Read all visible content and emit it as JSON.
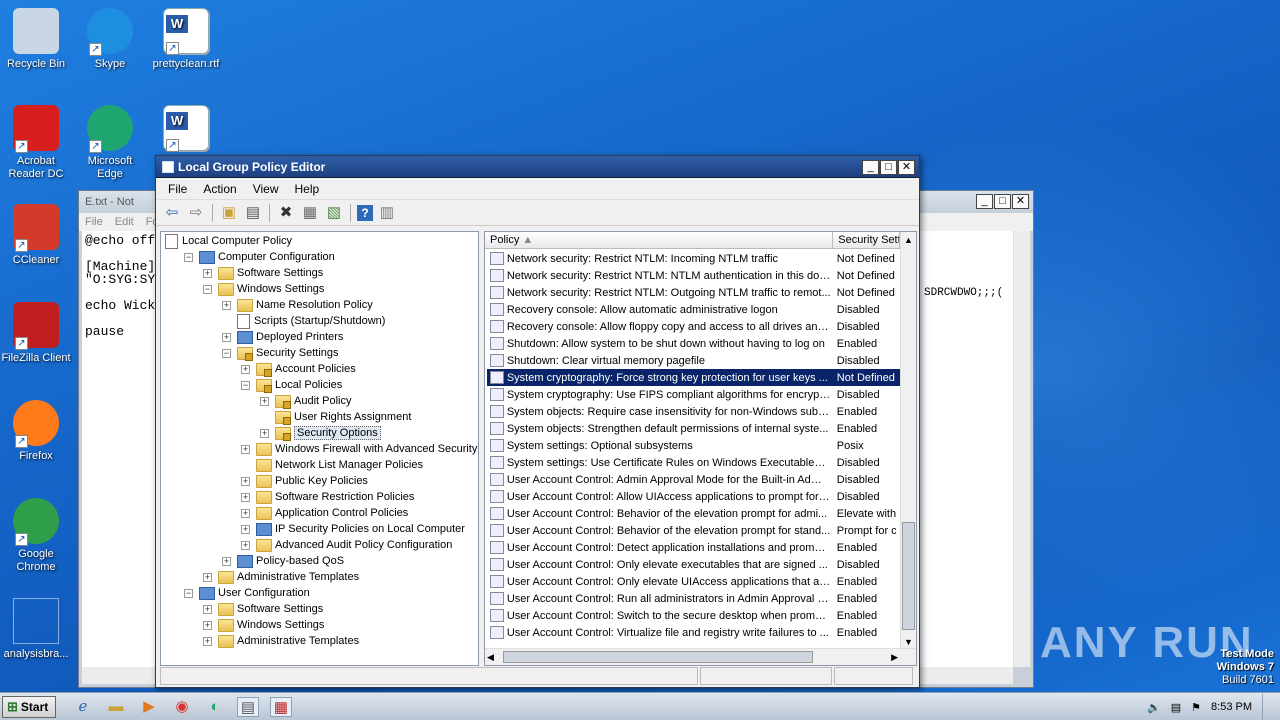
{
  "desktop": {
    "icons": [
      {
        "label": "Recycle Bin",
        "icon": "recycle-bin-icon",
        "color": "#c9d6e4"
      },
      {
        "label": "Skype",
        "icon": "skype-icon",
        "color": "#1e8fe0"
      },
      {
        "label": "prettyclean.rtf",
        "icon": "word-document-icon",
        "color": "#ffffff"
      },
      {
        "label": "Acrobat Reader DC",
        "icon": "acrobat-icon",
        "color": "#d81f1f"
      },
      {
        "label": "Microsoft Edge",
        "icon": "edge-icon",
        "color": "#1fa56f"
      },
      {
        "label": "",
        "icon": "word-document-icon",
        "color": "#ffffff"
      },
      {
        "label": "CCleaner",
        "icon": "ccleaner-icon",
        "color": "#d33a2c"
      },
      {
        "label": "FileZilla Client",
        "icon": "filezilla-icon",
        "color": "#bf1f1f"
      },
      {
        "label": "Firefox",
        "icon": "firefox-icon",
        "color": "#ff7a1a"
      },
      {
        "label": "Google Chrome",
        "icon": "chrome-icon",
        "color": "#2f9e4b"
      },
      {
        "label": "analysisbra...",
        "icon": "blank-file-icon",
        "color": "#1565c8"
      }
    ]
  },
  "notepad": {
    "title": "E.txt - Not",
    "menu": [
      "File",
      "Edit",
      "Fo"
    ],
    "content": "@echo off\n\n[Machine]\n\"O:SYG:SY\n\necho Wick\n\npause",
    "right_text": "SDRCWDWO;;;("
  },
  "gpedit": {
    "title": "Local Group Policy Editor",
    "menu": [
      "File",
      "Action",
      "View",
      "Help"
    ],
    "tree": [
      {
        "label": "Local Computer Policy",
        "level": 0,
        "exp": "",
        "icon": "doc"
      },
      {
        "label": "Computer Configuration",
        "level": 1,
        "exp": "−",
        "icon": "comp"
      },
      {
        "label": "Software Settings",
        "level": 2,
        "exp": "+",
        "icon": "fold"
      },
      {
        "label": "Windows Settings",
        "level": 2,
        "exp": "−",
        "icon": "fold"
      },
      {
        "label": "Name Resolution Policy",
        "level": 3,
        "exp": "+",
        "icon": "fold"
      },
      {
        "label": "Scripts (Startup/Shutdown)",
        "level": 3,
        "exp": "",
        "icon": "doc"
      },
      {
        "label": "Deployed Printers",
        "level": 3,
        "exp": "+",
        "icon": "comp"
      },
      {
        "label": "Security Settings",
        "level": 3,
        "exp": "−",
        "icon": "lock"
      },
      {
        "label": "Account Policies",
        "level": 4,
        "exp": "+",
        "icon": "lock"
      },
      {
        "label": "Local Policies",
        "level": 4,
        "exp": "−",
        "icon": "lock"
      },
      {
        "label": "Audit Policy",
        "level": 5,
        "exp": "+",
        "icon": "lock"
      },
      {
        "label": "User Rights Assignment",
        "level": 5,
        "exp": "",
        "icon": "lock"
      },
      {
        "label": "Security Options",
        "level": 5,
        "exp": "+",
        "icon": "lock",
        "selected": true
      },
      {
        "label": "Windows Firewall with Advanced Security",
        "level": 4,
        "exp": "+",
        "icon": "fold"
      },
      {
        "label": "Network List Manager Policies",
        "level": 4,
        "exp": "",
        "icon": "fold"
      },
      {
        "label": "Public Key Policies",
        "level": 4,
        "exp": "+",
        "icon": "fold"
      },
      {
        "label": "Software Restriction Policies",
        "level": 4,
        "exp": "+",
        "icon": "fold"
      },
      {
        "label": "Application Control Policies",
        "level": 4,
        "exp": "+",
        "icon": "fold"
      },
      {
        "label": "IP Security Policies on Local Computer",
        "level": 4,
        "exp": "+",
        "icon": "comp"
      },
      {
        "label": "Advanced Audit Policy Configuration",
        "level": 4,
        "exp": "+",
        "icon": "fold"
      },
      {
        "label": "Policy-based QoS",
        "level": 3,
        "exp": "+",
        "icon": "comp"
      },
      {
        "label": "Administrative Templates",
        "level": 2,
        "exp": "+",
        "icon": "fold"
      },
      {
        "label": "User Configuration",
        "level": 1,
        "exp": "−",
        "icon": "comp"
      },
      {
        "label": "Software Settings",
        "level": 2,
        "exp": "+",
        "icon": "fold"
      },
      {
        "label": "Windows Settings",
        "level": 2,
        "exp": "+",
        "icon": "fold"
      },
      {
        "label": "Administrative Templates",
        "level": 2,
        "exp": "+",
        "icon": "fold"
      }
    ],
    "columns": [
      "Policy",
      "Security Sett"
    ],
    "rows": [
      {
        "policy": "Network security: Restrict NTLM: Incoming NTLM traffic",
        "setting": "Not Defined"
      },
      {
        "policy": "Network security: Restrict NTLM: NTLM authentication in this dom...",
        "setting": "Not Defined"
      },
      {
        "policy": "Network security: Restrict NTLM: Outgoing NTLM traffic to remot...",
        "setting": "Not Defined"
      },
      {
        "policy": "Recovery console: Allow automatic administrative logon",
        "setting": "Disabled"
      },
      {
        "policy": "Recovery console: Allow floppy copy and access to all drives and ...",
        "setting": "Disabled"
      },
      {
        "policy": "Shutdown: Allow system to be shut down without having to log on",
        "setting": "Enabled"
      },
      {
        "policy": "Shutdown: Clear virtual memory pagefile",
        "setting": "Disabled"
      },
      {
        "policy": "System cryptography: Force strong key protection for user keys ...",
        "setting": "Not Defined",
        "selected": true
      },
      {
        "policy": "System cryptography: Use FIPS compliant algorithms for encrypti...",
        "setting": "Disabled"
      },
      {
        "policy": "System objects: Require case insensitivity for non-Windows subs...",
        "setting": "Enabled"
      },
      {
        "policy": "System objects: Strengthen default permissions of internal syste...",
        "setting": "Enabled"
      },
      {
        "policy": "System settings: Optional subsystems",
        "setting": "Posix"
      },
      {
        "policy": "System settings: Use Certificate Rules on Windows Executables f...",
        "setting": "Disabled"
      },
      {
        "policy": "User Account Control: Admin Approval Mode for the Built-in Admi...",
        "setting": "Disabled"
      },
      {
        "policy": "User Account Control: Allow UIAccess applications to prompt for ...",
        "setting": "Disabled"
      },
      {
        "policy": "User Account Control: Behavior of the elevation prompt for admi...",
        "setting": "Elevate with"
      },
      {
        "policy": "User Account Control: Behavior of the elevation prompt for stand...",
        "setting": "Prompt for c"
      },
      {
        "policy": "User Account Control: Detect application installations and prompt...",
        "setting": "Enabled"
      },
      {
        "policy": "User Account Control: Only elevate executables that are signed ...",
        "setting": "Disabled"
      },
      {
        "policy": "User Account Control: Only elevate UIAccess applications that ar...",
        "setting": "Enabled"
      },
      {
        "policy": "User Account Control: Run all administrators in Admin Approval M...",
        "setting": "Enabled"
      },
      {
        "policy": "User Account Control: Switch to the secure desktop when prompt...",
        "setting": "Enabled"
      },
      {
        "policy": "User Account Control: Virtualize file and registry write failures to ...",
        "setting": "Enabled"
      }
    ]
  },
  "taskbar": {
    "start_label": "Start",
    "time": "8:53 PM"
  },
  "watermark": {
    "logo": "ANY RUN",
    "mode": "Test Mode",
    "os": "Windows 7",
    "build": "Build 7601"
  }
}
